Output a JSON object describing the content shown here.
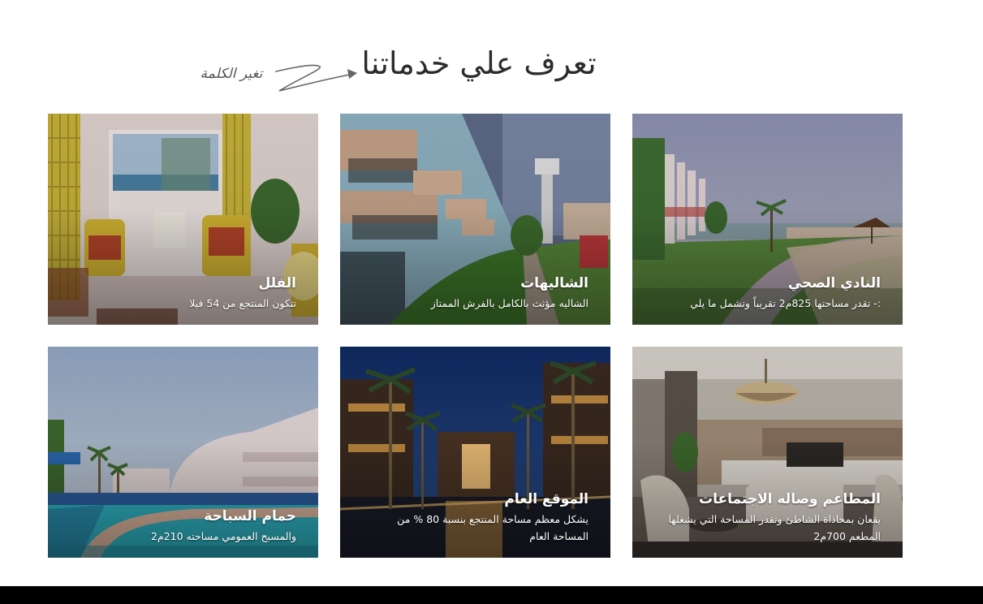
{
  "section": {
    "title": "تعرف علي خدماتنا",
    "annotation": "تغير الكلمة"
  },
  "cards": [
    {
      "title": "النادي الصحي",
      "description": ":- تقدر مساحتها 825م2 تقريباً وتشمل ما يلي"
    },
    {
      "title": "الشاليهات",
      "description": "الشاليه مؤثث بالكامل بالفرش الممتاز"
    },
    {
      "title": "الفلل",
      "description": "تتكون المنتجع من 54 فيلا"
    },
    {
      "title": "المطاعم وصاله الاجتماعات",
      "description": "يقعان بمحاذاة الشاطئ وتقدر المساحة التي يشغلها المطعم 700م2"
    },
    {
      "title": "الموقع العام",
      "description": "يشكل معظم مساحة المنتجع بنسبة 80 % من المساحة العام"
    },
    {
      "title": "حمام السباحة",
      "description": "والمسبح العمومي مساحته 210م2"
    }
  ]
}
